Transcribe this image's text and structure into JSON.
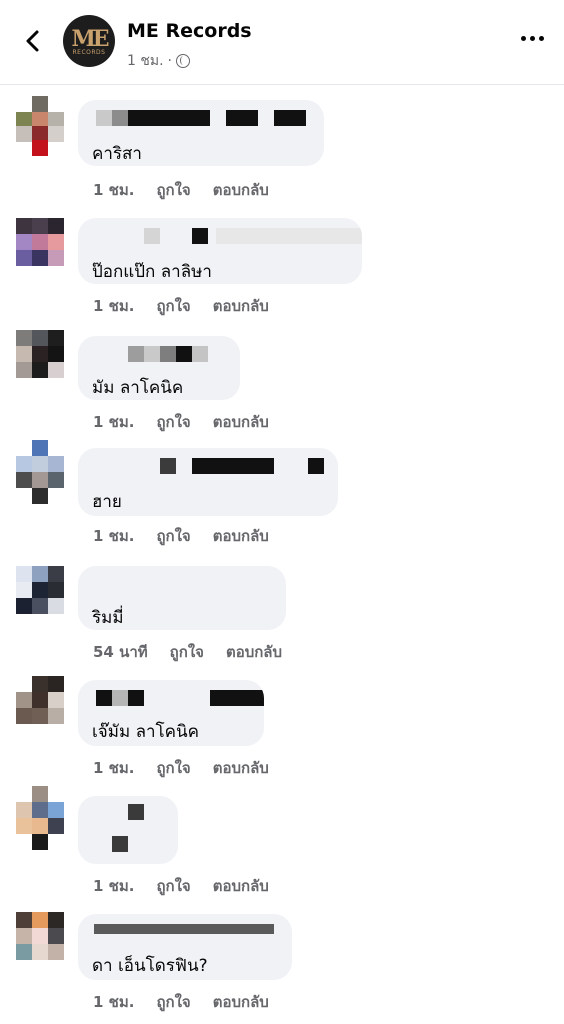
{
  "header": {
    "title": "ME Records",
    "time": "1 ชม.",
    "separator": "·",
    "avatar_logo": "ME",
    "avatar_sub": "RECORDS"
  },
  "actions": {
    "like": "ถูกใจ",
    "reply": "ตอบกลับ"
  },
  "comments": [
    {
      "text": "คาริสา",
      "time": "1 ชม."
    },
    {
      "text": "ป๊อกแป๊ก ลาลิษา",
      "time": "1 ชม."
    },
    {
      "text": "มัม ลาโคนิค",
      "time": "1 ชม."
    },
    {
      "text": "ฮาย",
      "time": "1 ชม."
    },
    {
      "text": "ริมมี่",
      "time": "54 นาที"
    },
    {
      "text": "เจ๊มัม ลาโคนิค",
      "time": "1 ชม."
    },
    {
      "text": "",
      "time": "1 ชม."
    },
    {
      "text": "ดา เอ็นโดรฟิน?",
      "time": "1 ชม."
    }
  ]
}
